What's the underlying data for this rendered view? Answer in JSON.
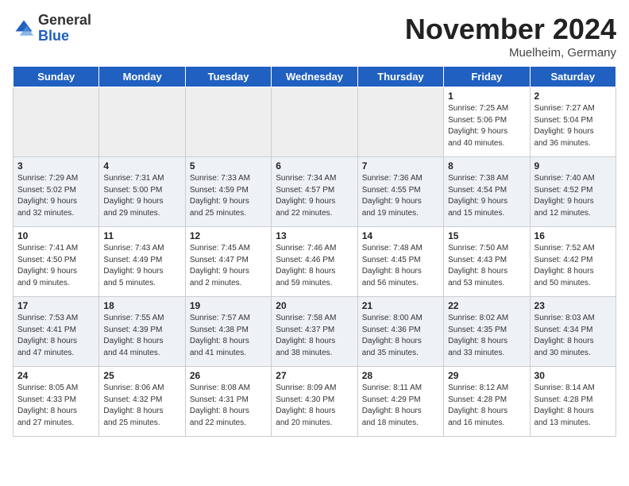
{
  "logo": {
    "general": "General",
    "blue": "Blue"
  },
  "title": "November 2024",
  "location": "Muelheim, Germany",
  "weekdays": [
    "Sunday",
    "Monday",
    "Tuesday",
    "Wednesday",
    "Thursday",
    "Friday",
    "Saturday"
  ],
  "weeks": [
    [
      {
        "num": "",
        "info": ""
      },
      {
        "num": "",
        "info": ""
      },
      {
        "num": "",
        "info": ""
      },
      {
        "num": "",
        "info": ""
      },
      {
        "num": "",
        "info": ""
      },
      {
        "num": "1",
        "info": "Sunrise: 7:25 AM\nSunset: 5:06 PM\nDaylight: 9 hours\nand 40 minutes."
      },
      {
        "num": "2",
        "info": "Sunrise: 7:27 AM\nSunset: 5:04 PM\nDaylight: 9 hours\nand 36 minutes."
      }
    ],
    [
      {
        "num": "3",
        "info": "Sunrise: 7:29 AM\nSunset: 5:02 PM\nDaylight: 9 hours\nand 32 minutes."
      },
      {
        "num": "4",
        "info": "Sunrise: 7:31 AM\nSunset: 5:00 PM\nDaylight: 9 hours\nand 29 minutes."
      },
      {
        "num": "5",
        "info": "Sunrise: 7:33 AM\nSunset: 4:59 PM\nDaylight: 9 hours\nand 25 minutes."
      },
      {
        "num": "6",
        "info": "Sunrise: 7:34 AM\nSunset: 4:57 PM\nDaylight: 9 hours\nand 22 minutes."
      },
      {
        "num": "7",
        "info": "Sunrise: 7:36 AM\nSunset: 4:55 PM\nDaylight: 9 hours\nand 19 minutes."
      },
      {
        "num": "8",
        "info": "Sunrise: 7:38 AM\nSunset: 4:54 PM\nDaylight: 9 hours\nand 15 minutes."
      },
      {
        "num": "9",
        "info": "Sunrise: 7:40 AM\nSunset: 4:52 PM\nDaylight: 9 hours\nand 12 minutes."
      }
    ],
    [
      {
        "num": "10",
        "info": "Sunrise: 7:41 AM\nSunset: 4:50 PM\nDaylight: 9 hours\nand 9 minutes."
      },
      {
        "num": "11",
        "info": "Sunrise: 7:43 AM\nSunset: 4:49 PM\nDaylight: 9 hours\nand 5 minutes."
      },
      {
        "num": "12",
        "info": "Sunrise: 7:45 AM\nSunset: 4:47 PM\nDaylight: 9 hours\nand 2 minutes."
      },
      {
        "num": "13",
        "info": "Sunrise: 7:46 AM\nSunset: 4:46 PM\nDaylight: 8 hours\nand 59 minutes."
      },
      {
        "num": "14",
        "info": "Sunrise: 7:48 AM\nSunset: 4:45 PM\nDaylight: 8 hours\nand 56 minutes."
      },
      {
        "num": "15",
        "info": "Sunrise: 7:50 AM\nSunset: 4:43 PM\nDaylight: 8 hours\nand 53 minutes."
      },
      {
        "num": "16",
        "info": "Sunrise: 7:52 AM\nSunset: 4:42 PM\nDaylight: 8 hours\nand 50 minutes."
      }
    ],
    [
      {
        "num": "17",
        "info": "Sunrise: 7:53 AM\nSunset: 4:41 PM\nDaylight: 8 hours\nand 47 minutes."
      },
      {
        "num": "18",
        "info": "Sunrise: 7:55 AM\nSunset: 4:39 PM\nDaylight: 8 hours\nand 44 minutes."
      },
      {
        "num": "19",
        "info": "Sunrise: 7:57 AM\nSunset: 4:38 PM\nDaylight: 8 hours\nand 41 minutes."
      },
      {
        "num": "20",
        "info": "Sunrise: 7:58 AM\nSunset: 4:37 PM\nDaylight: 8 hours\nand 38 minutes."
      },
      {
        "num": "21",
        "info": "Sunrise: 8:00 AM\nSunset: 4:36 PM\nDaylight: 8 hours\nand 35 minutes."
      },
      {
        "num": "22",
        "info": "Sunrise: 8:02 AM\nSunset: 4:35 PM\nDaylight: 8 hours\nand 33 minutes."
      },
      {
        "num": "23",
        "info": "Sunrise: 8:03 AM\nSunset: 4:34 PM\nDaylight: 8 hours\nand 30 minutes."
      }
    ],
    [
      {
        "num": "24",
        "info": "Sunrise: 8:05 AM\nSunset: 4:33 PM\nDaylight: 8 hours\nand 27 minutes."
      },
      {
        "num": "25",
        "info": "Sunrise: 8:06 AM\nSunset: 4:32 PM\nDaylight: 8 hours\nand 25 minutes."
      },
      {
        "num": "26",
        "info": "Sunrise: 8:08 AM\nSunset: 4:31 PM\nDaylight: 8 hours\nand 22 minutes."
      },
      {
        "num": "27",
        "info": "Sunrise: 8:09 AM\nSunset: 4:30 PM\nDaylight: 8 hours\nand 20 minutes."
      },
      {
        "num": "28",
        "info": "Sunrise: 8:11 AM\nSunset: 4:29 PM\nDaylight: 8 hours\nand 18 minutes."
      },
      {
        "num": "29",
        "info": "Sunrise: 8:12 AM\nSunset: 4:28 PM\nDaylight: 8 hours\nand 16 minutes."
      },
      {
        "num": "30",
        "info": "Sunrise: 8:14 AM\nSunset: 4:28 PM\nDaylight: 8 hours\nand 13 minutes."
      }
    ]
  ]
}
